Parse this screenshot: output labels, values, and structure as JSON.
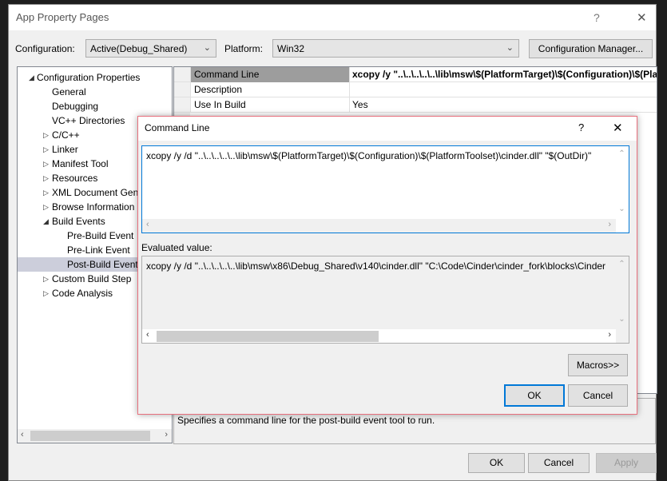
{
  "main": {
    "title": "App Property Pages",
    "help_label": "?",
    "close_label": "✕",
    "configuration_label": "Configuration:",
    "configuration_value": "Active(Debug_Shared)",
    "platform_label": "Platform:",
    "platform_value": "Win32",
    "config_manager_label": "Configuration Manager...",
    "tree": [
      {
        "label": "Configuration Properties",
        "expander": "expanded",
        "level": 0
      },
      {
        "label": "General",
        "expander": "",
        "level": 1
      },
      {
        "label": "Debugging",
        "expander": "",
        "level": 1
      },
      {
        "label": "VC++ Directories",
        "expander": "",
        "level": 1
      },
      {
        "label": "C/C++",
        "expander": "collapsed",
        "level": 1
      },
      {
        "label": "Linker",
        "expander": "collapsed",
        "level": 1
      },
      {
        "label": "Manifest Tool",
        "expander": "collapsed",
        "level": 1
      },
      {
        "label": "Resources",
        "expander": "collapsed",
        "level": 1
      },
      {
        "label": "XML Document Generator",
        "expander": "collapsed",
        "level": 1
      },
      {
        "label": "Browse Information",
        "expander": "collapsed",
        "level": 1
      },
      {
        "label": "Build Events",
        "expander": "expanded",
        "level": 1
      },
      {
        "label": "Pre-Build Event",
        "expander": "",
        "level": 2
      },
      {
        "label": "Pre-Link Event",
        "expander": "",
        "level": 2
      },
      {
        "label": "Post-Build Event",
        "expander": "",
        "level": 2,
        "selected": true
      },
      {
        "label": "Custom Build Step",
        "expander": "collapsed",
        "level": 1
      },
      {
        "label": "Code Analysis",
        "expander": "collapsed",
        "level": 1
      }
    ],
    "grid": [
      {
        "name": "Command Line",
        "value": "xcopy /y \"..\\..\\..\\..\\..\\lib\\msw\\$(PlatformTarget)\\$(Configuration)\\$(PlatformToolset)\\cinder.dll\" \"$(OutDir)\""
      },
      {
        "name": "Description",
        "value": ""
      },
      {
        "name": "Use In Build",
        "value": "Yes"
      }
    ],
    "description": "Specifies a command line for the post-build event tool to run.",
    "ok_label": "OK",
    "cancel_label": "Cancel",
    "apply_label": "Apply"
  },
  "cmd_dialog": {
    "title": "Command Line",
    "help_label": "?",
    "close_label": "✕",
    "command_value": "xcopy /y /d \"..\\..\\..\\..\\..\\lib\\msw\\$(PlatformTarget)\\$(Configuration)\\$(PlatformToolset)\\cinder.dll\" \"$(OutDir)\"",
    "evaluated_label": "Evaluated value:",
    "evaluated_value": "xcopy /y /d \"..\\..\\..\\..\\..\\lib\\msw\\x86\\Debug_Shared\\v140\\cinder.dll\" \"C:\\Code\\Cinder\\cinder_fork\\blocks\\Cinder",
    "macros_label": "Macros>>",
    "ok_label": "OK",
    "cancel_label": "Cancel"
  },
  "colors": {
    "accent": "#0078d7",
    "dialog_border": "#e8707d",
    "selection": "#cccedb"
  }
}
